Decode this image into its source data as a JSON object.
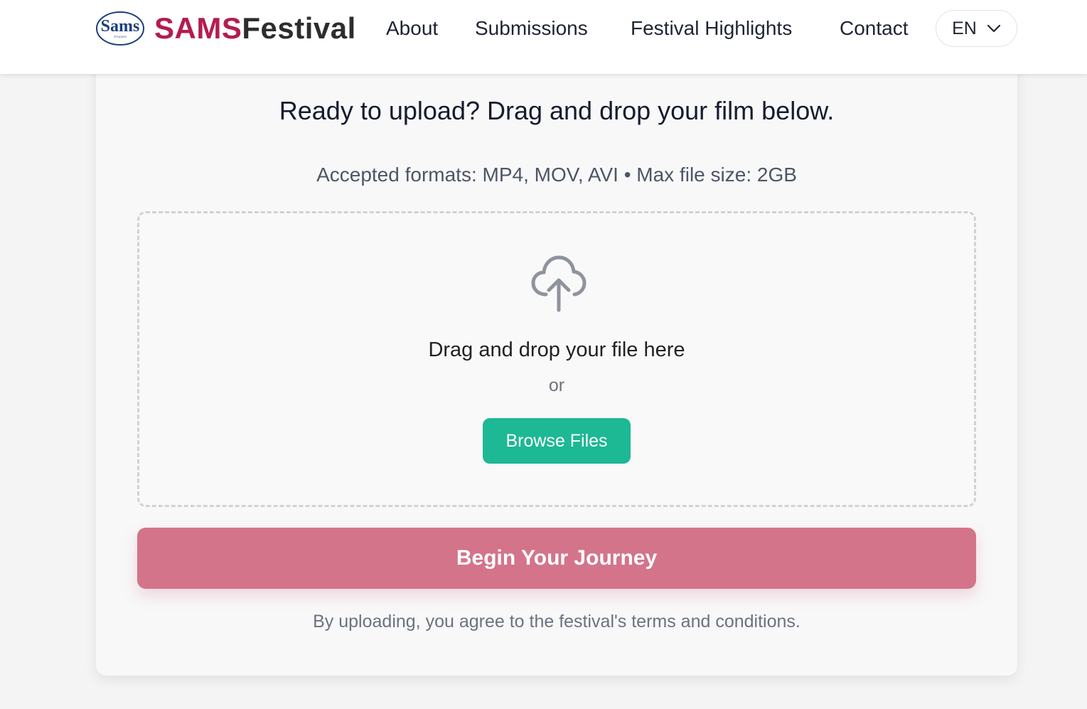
{
  "header": {
    "logo_text": "Sams",
    "logo_subtext": "STUDIOS",
    "brand_part1": "SAMS",
    "brand_part2": "Festival",
    "nav": [
      "About",
      "Submissions",
      "Festival Highlights",
      "Contact"
    ],
    "language": "EN"
  },
  "upload": {
    "heading": "Ready to upload? Drag and drop your film below.",
    "formats": "Accepted formats: MP4, MOV, AVI • Max file size: 2GB",
    "drop_text": "Drag and drop your file here",
    "or_text": "or",
    "browse_label": "Browse Files",
    "submit_label": "Begin Your Journey",
    "terms": "By uploading, you agree to the festival's terms and conditions."
  },
  "colors": {
    "brand_red": "#b41c50",
    "browse_green": "#1db894",
    "submit_pink": "#d3748b"
  }
}
